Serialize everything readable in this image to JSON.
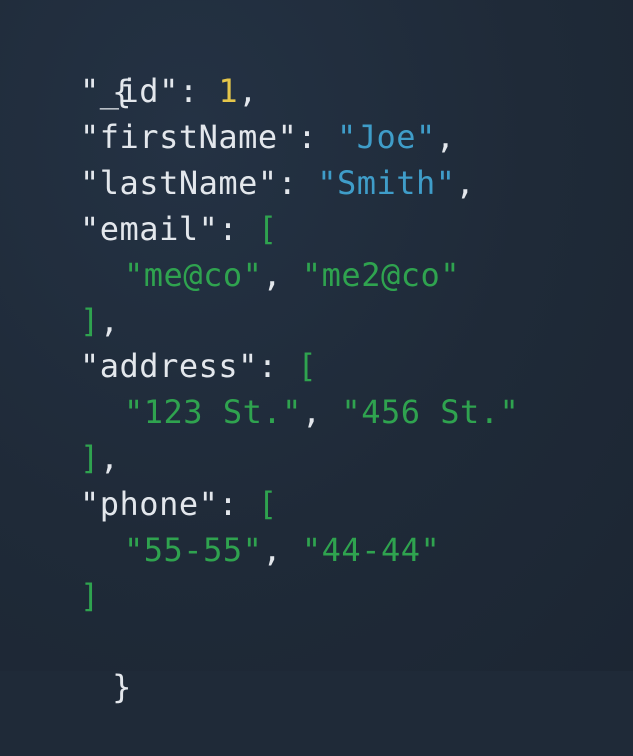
{
  "code": {
    "open_brace": "{",
    "close_brace": "}",
    "id_line": {
      "key": "\"_id\"",
      "colon": ": ",
      "value": "1",
      "comma": ","
    },
    "first_name_line": {
      "key": "\"firstName\"",
      "colon": ": ",
      "value": "\"Joe\"",
      "comma": ","
    },
    "last_name_line": {
      "key": "\"lastName\"",
      "colon": ": ",
      "value": "\"Smith\"",
      "comma": ","
    },
    "email_line": {
      "key": "\"email\"",
      "colon": ": ",
      "open": "["
    },
    "email_values": {
      "v1": "\"me@co\"",
      "sep": ", ",
      "v2": "\"me2@co\""
    },
    "email_close": {
      "close": "]",
      "comma": ","
    },
    "address_line": {
      "key": "\"address\"",
      "colon": ": ",
      "open": "["
    },
    "address_values": {
      "v1": "\"123 St.\"",
      "sep": ", ",
      "v2": "\"456 St.\""
    },
    "address_close": {
      "close": "]",
      "comma": ","
    },
    "phone_line": {
      "key": "\"phone\"",
      "colon": ": ",
      "open": "["
    },
    "phone_values": {
      "v1": "\"55-55\"",
      "sep": ", ",
      "v2": "\"44-44\""
    },
    "phone_close": {
      "close": "]"
    }
  },
  "colors": {
    "background": "#1f2a38",
    "punctuation": "#e3e7ec",
    "number": "#e5c64a",
    "string": "#3f9dc9",
    "array": "#2fa34f"
  }
}
